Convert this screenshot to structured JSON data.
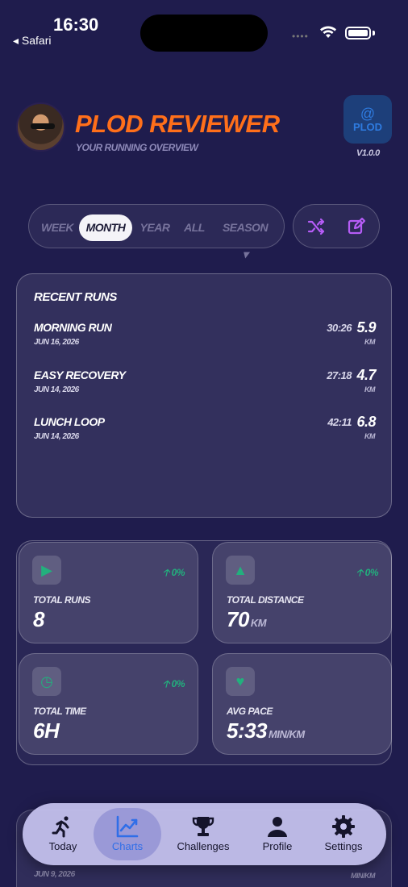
{
  "status_bar": {
    "time": "16:30",
    "back_label": "◂ Safari",
    "dots": "••••"
  },
  "header": {
    "title": "PLOD REVIEWER",
    "subtitle": "YOUR RUNNING OVERVIEW",
    "logo_text": "PLOD",
    "version": "V1.0.0"
  },
  "periods": {
    "items": [
      "WEEK",
      "MONTH",
      "YEAR",
      "ALL",
      "SEASON ▾"
    ],
    "selected": "MONTH"
  },
  "recent_runs": {
    "title": "RECENT RUNS",
    "runs": [
      {
        "name": "MORNING RUN",
        "date": "JUN 16, 2026",
        "time": "30:26",
        "distance": "5.9",
        "unit": "KM"
      },
      {
        "name": "EASY RECOVERY",
        "date": "JUN 14, 2026",
        "time": "27:18",
        "distance": "4.7",
        "unit": "KM"
      },
      {
        "name": "LUNCH LOOP",
        "date": "JUN 14, 2026",
        "time": "42:11",
        "distance": "6.8",
        "unit": "KM"
      }
    ]
  },
  "stats": [
    {
      "icon": "play-icon",
      "change": "0%",
      "label": "TOTAL RUNS",
      "value": "8",
      "unit": ""
    },
    {
      "icon": "road-icon",
      "change": "0%",
      "label": "TOTAL DISTANCE",
      "value": "70",
      "unit": "KM"
    },
    {
      "icon": "clock-icon",
      "change": "0%",
      "label": "TOTAL TIME",
      "value": "6H",
      "unit": ""
    },
    {
      "icon": "heart-icon",
      "change": "",
      "label": "AVG PACE",
      "value": "5:33",
      "unit": "MIN/KM"
    }
  ],
  "ghost_card": {
    "date": "JUN 9, 2026",
    "unit": "MIN/KM"
  },
  "tabs": [
    {
      "label": "Today",
      "icon": "runner-icon"
    },
    {
      "label": "Charts",
      "icon": "chart-icon"
    },
    {
      "label": "Challenges",
      "icon": "trophy-icon"
    },
    {
      "label": "Profile",
      "icon": "person-icon"
    },
    {
      "label": "Settings",
      "icon": "gear-icon"
    }
  ],
  "active_tab": "Charts",
  "colors": {
    "background": "#1f1c4d",
    "accent_orange": "#ff6f1a",
    "positive": "#22b07d",
    "action_purple": "#b55cf6",
    "tab_active": "#2f6ee8"
  }
}
